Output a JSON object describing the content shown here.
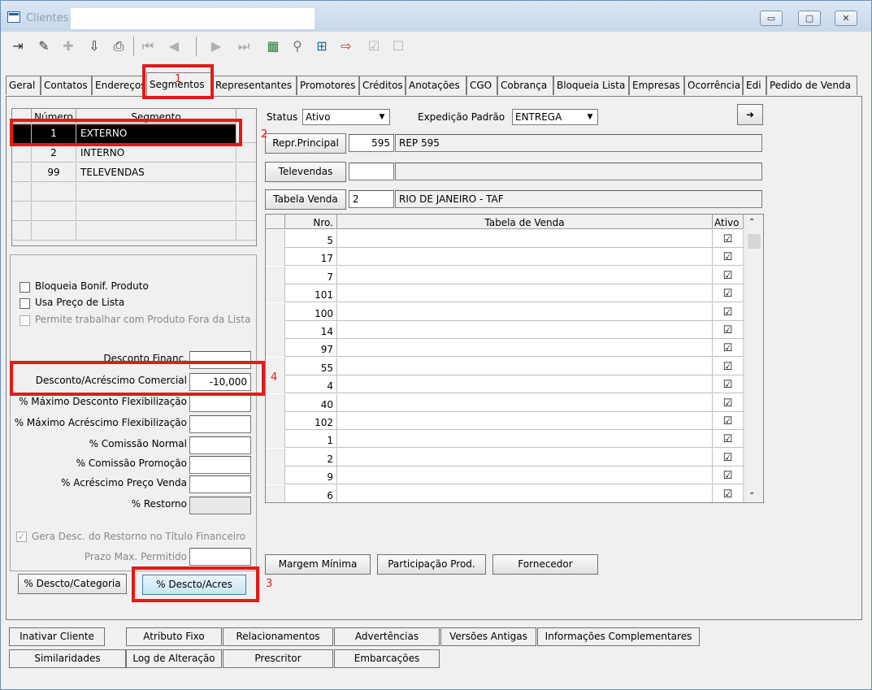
{
  "window": {
    "title": "Clientes",
    "min_glyph": "▭",
    "max_glyph": "▢",
    "close_glyph": "✕"
  },
  "toolbar": {
    "icons": [
      "exit-icon",
      "edit-icon",
      "add-icon",
      "save-icon",
      "print-icon",
      "first-record-icon",
      "prev-record-icon",
      "next-record-icon",
      "last-record-icon",
      "grid-icon",
      "find-icon",
      "insert-icon",
      "import-icon",
      "check-icon",
      "list-icon"
    ]
  },
  "tabs": [
    "Geral",
    "Contatos",
    "Endereços",
    "Segmentos",
    "Representantes",
    "Promotores",
    "Créditos",
    "Anotações",
    "CGO",
    "Cobrança",
    "Bloqueia Lista",
    "Empresas",
    "Ocorrência",
    "Edi",
    "Pedido de Venda"
  ],
  "segment_grid": {
    "headers": [
      "Número",
      "Segmento"
    ],
    "rows": [
      {
        "num": "1",
        "name": "EXTERNO"
      },
      {
        "num": "2",
        "name": "INTERNO"
      },
      {
        "num": "99",
        "name": "TELEVENDAS"
      }
    ]
  },
  "options": {
    "bloqueia_bonif": "Bloqueia Bonif. Produto",
    "usa_preco_lista": "Usa Preço de Lista",
    "permite_fora_lista": "Permite trabalhar com Produto Fora da Lista"
  },
  "fields": {
    "desconto_financ": {
      "label": "Desconto Financ.",
      "value": ""
    },
    "desconto_acrescimo": {
      "label": "Desconto/Acréscimo Comercial",
      "value": "-10,000"
    },
    "max_desc_flex": {
      "label": "% Máximo Desconto Flexibilização",
      "value": ""
    },
    "max_acresc_flex": {
      "label": "% Máximo Acréscimo Flexibilização",
      "value": ""
    },
    "comissao_normal": {
      "label": "% Comissão Normal",
      "value": ""
    },
    "comissao_promocao": {
      "label": "% Comissão Promoção",
      "value": ""
    },
    "acrescimo_preco": {
      "label": "% Acréscimo Preço Venda",
      "value": ""
    },
    "restorno": {
      "label": "% Restorno",
      "value": ""
    },
    "gera_desc": "Gera Desc. do Restorno no Título Financeiro",
    "prazo_max": {
      "label": "Prazo Max. Permitido",
      "value": ""
    }
  },
  "buttons": {
    "desc_categoria": "% Descto/Categoria",
    "desc_acres": "% Descto/Acres",
    "margem_minima": "Margem Mínima",
    "participacao": "Participação Prod.",
    "fornecedor": "Fornecedor"
  },
  "right": {
    "status_label": "Status",
    "status_value": "Ativo",
    "expedicao_label": "Expedição Padrão",
    "expedicao_value": "ENTREGA",
    "repr_label": "Repr.Principal",
    "repr_code": "595",
    "repr_name": "REP 595",
    "televendas_label": "Televendas",
    "televendas_code": "",
    "tabela_label": "Tabela Venda",
    "tabela_code": "2",
    "tabela_name": "RIO DE JANEIRO - TAF"
  },
  "price_grid": {
    "headers": [
      "Nro.",
      "Tabela de Venda",
      "Ativo"
    ],
    "rows": [
      "5",
      "17",
      "7",
      "101",
      "100",
      "14",
      "97",
      "55",
      "4",
      "40",
      "102",
      "1",
      "2",
      "9",
      "6"
    ],
    "check_glyph": "☑"
  },
  "annotations": [
    "1",
    "2",
    "3",
    "4"
  ],
  "bottom_buttons": {
    "row1": [
      "Inativar Cliente",
      "Atributo Fixo",
      "Relacionamentos",
      "Advertências",
      "Versões Antigas",
      "Informações Complementares"
    ],
    "row2": [
      "Similaridades",
      "Log de Alteração",
      "Prescritor",
      "Embarcações"
    ]
  },
  "colors": {
    "annotation": "#e21a1a",
    "selected_row": "#000000"
  }
}
